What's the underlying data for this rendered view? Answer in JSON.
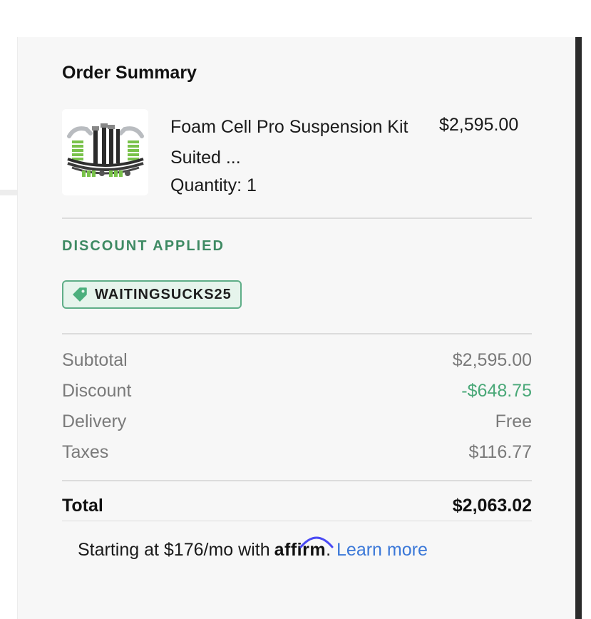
{
  "order_summary": {
    "title": "Order Summary",
    "item": {
      "name": "Foam Cell Pro Suspension Kit Suited ...",
      "quantity": "Quantity: 1",
      "price": "$2,595.00"
    },
    "discount": {
      "heading": "DISCOUNT APPLIED",
      "code": "WAITINGSUCKS25"
    },
    "lines": [
      {
        "label": "Subtotal",
        "value": "$2,595.00"
      },
      {
        "label": "Discount",
        "value": "-$648.75"
      },
      {
        "label": "Delivery",
        "value": "Free"
      },
      {
        "label": "Taxes",
        "value": "$116.77"
      }
    ],
    "total": {
      "label": "Total",
      "value": "$2,063.02"
    },
    "financing": {
      "prefix": "Starting at $176/mo with",
      "brand": "affirm",
      "suffix": ".",
      "link": "Learn more"
    }
  },
  "colors": {
    "panel_bg": "#f7f7f7",
    "discount_green": "#3e8a63",
    "coupon_bg": "#e6f4ec",
    "link_blue": "#3b78d8",
    "affirm_arc": "#4a4af4"
  },
  "icons": {
    "coupon": "tag-icon",
    "product": "product-thumbnail"
  }
}
